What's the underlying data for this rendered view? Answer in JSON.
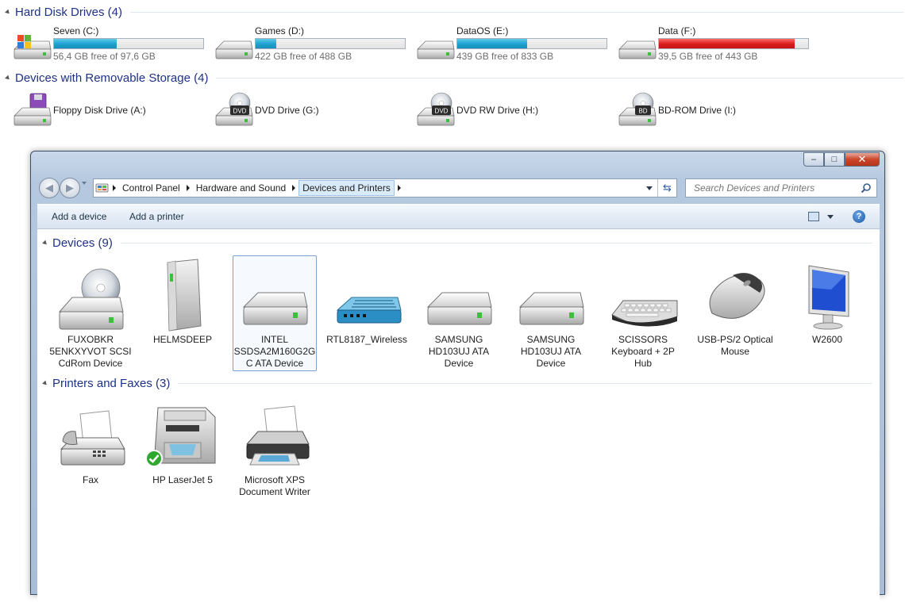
{
  "computer": {
    "hard_disk_group": "Hard Disk Drives (4)",
    "removable_group": "Devices with Removable Storage (4)",
    "drives": [
      {
        "name": "Seven (C:)",
        "free_text": "56,4 GB free of 97,6 GB",
        "used_fraction": 0.42,
        "bar_color": "#1ea0cf",
        "icon": "windows-drive-icon"
      },
      {
        "name": "Games (D:)",
        "free_text": "422 GB free of 488 GB",
        "used_fraction": 0.14,
        "bar_color": "#1ea0cf",
        "icon": "hard-drive-icon"
      },
      {
        "name": "DataOS (E:)",
        "free_text": "439 GB free of 833 GB",
        "used_fraction": 0.47,
        "bar_color": "#1ea0cf",
        "icon": "hard-drive-icon"
      },
      {
        "name": "Data (F:)",
        "free_text": "39,5 GB free of 443 GB",
        "used_fraction": 0.91,
        "bar_color": "#d81c1c",
        "icon": "hard-drive-icon"
      }
    ],
    "removable": [
      {
        "name": "Floppy Disk Drive (A:)",
        "icon": "floppy-drive-icon"
      },
      {
        "name": "DVD Drive (G:)",
        "icon": "dvd-drive-icon",
        "label": "DVD"
      },
      {
        "name": "DVD RW Drive (H:)",
        "icon": "dvd-rw-drive-icon",
        "label": "DVD"
      },
      {
        "name": "BD-ROM Drive (I:)",
        "icon": "bd-rom-drive-icon",
        "label": "BD"
      }
    ]
  },
  "window": {
    "controls": {
      "minimize": "–",
      "maximize": "□",
      "close": "✕"
    },
    "breadcrumb": [
      "Control Panel",
      "Hardware and Sound",
      "Devices and Printers"
    ],
    "search_placeholder": "Search Devices and Printers",
    "commands": {
      "add_device": "Add a device",
      "add_printer": "Add a printer",
      "help": "?"
    },
    "devices_group": "Devices (9)",
    "printers_group": "Printers and Faxes (3)",
    "devices": [
      {
        "name": "FUXOBKR 5ENKXYVOT SCSI CdRom Device",
        "icon": "cdrom-drive-icon",
        "selected": false
      },
      {
        "name": "HELMSDEEP",
        "icon": "computer-tower-icon",
        "selected": false
      },
      {
        "name": "INTEL SSDSA2M160G2G C ATA Device",
        "icon": "hard-drive-icon",
        "selected": true
      },
      {
        "name": "RTL8187_Wireless",
        "icon": "wireless-adapter-icon",
        "selected": false
      },
      {
        "name": "SAMSUNG HD103UJ ATA Device",
        "icon": "hard-drive-icon",
        "selected": false
      },
      {
        "name": "SAMSUNG HD103UJ ATA Device",
        "icon": "hard-drive-icon",
        "selected": false
      },
      {
        "name": "SCISSORS Keyboard + 2P Hub",
        "icon": "keyboard-icon",
        "selected": false
      },
      {
        "name": "USB-PS/2 Optical Mouse",
        "icon": "mouse-icon",
        "selected": false
      },
      {
        "name": "W2600",
        "icon": "monitor-icon",
        "selected": false
      }
    ],
    "printers": [
      {
        "name": "Fax",
        "icon": "fax-icon",
        "default": false
      },
      {
        "name": "HP LaserJet 5",
        "icon": "laser-printer-icon",
        "default": true
      },
      {
        "name": "Microsoft XPS Document Writer",
        "icon": "printer-icon",
        "default": false
      }
    ]
  }
}
